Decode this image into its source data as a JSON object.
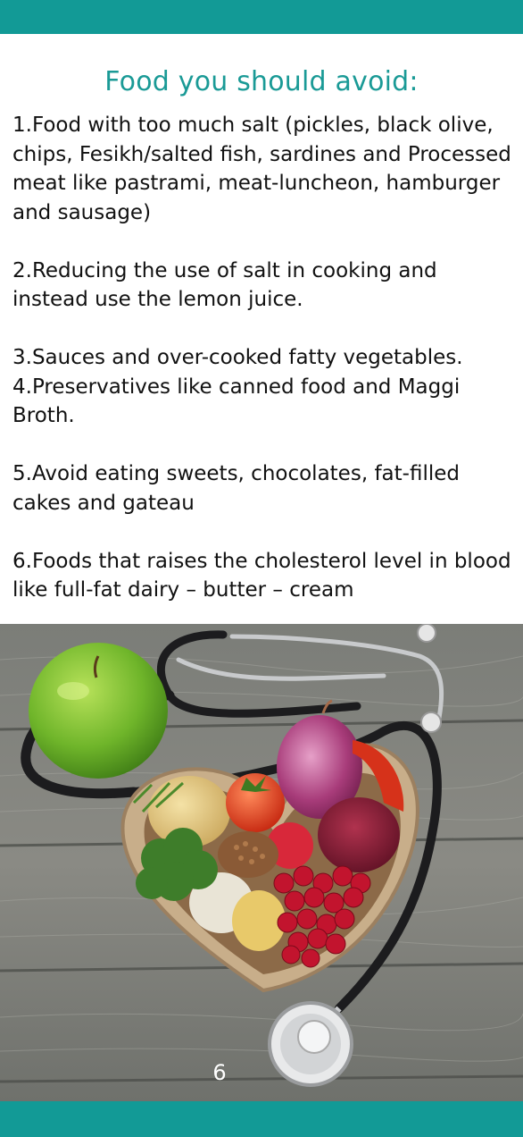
{
  "heading": "Food you should avoid:",
  "items": [
    "1.Food with too much salt (pickles, black olive, chips, Fesikh/salted fish, sardines and Processed meat like pastrami, meat-luncheon, hamburger and sausage)",
    "2.Reducing the use of salt in cooking and instead use the lemon juice.",
    "3.Sauces and over-cooked fatty vegetables.",
    "4.Preservatives like canned food and Maggi Broth.",
    "5.Avoid eating sweets, chocolates, fat-filled cakes and gateau",
    "6.Foods that raises the cholesterol level in blood like full-fat dairy – butter – cream"
  ],
  "page_number": "6",
  "colors": {
    "accent": "#129a96",
    "heading": "#1a9a96",
    "text": "#111111"
  },
  "photo": {
    "subject": "heart-shaped bowl of vegetables with stethoscope and green apple on wooden boards"
  }
}
